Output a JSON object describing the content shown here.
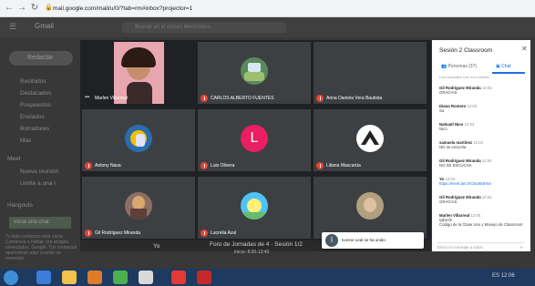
{
  "browser": {
    "url": "mail.google.com/mail/u/0/?tab=rm#inbox?projector=1",
    "back_icon": "arrow-left-icon",
    "forward_icon": "arrow-right-icon",
    "reload_icon": "reload-icon",
    "lock_icon": "lock-icon"
  },
  "gmail": {
    "logo": "Gmail",
    "search_placeholder": "Buscar en el correo electrónico",
    "compose_label": "Redactar",
    "sidebar": [
      {
        "label": "Recibidos",
        "icon": "inbox-icon"
      },
      {
        "label": "Destacados",
        "icon": "star-icon"
      },
      {
        "label": "Pospuestos",
        "icon": "clock-icon"
      },
      {
        "label": "Enviados",
        "icon": "send-icon"
      },
      {
        "label": "Borradores",
        "icon": "draft-icon"
      },
      {
        "label": "Más",
        "icon": "chevron-down-icon"
      }
    ],
    "meet_header": "Meet",
    "meet_items": [
      {
        "label": "Nueva reunión",
        "icon": "video-icon"
      },
      {
        "label": "Unirte a una r",
        "icon": "keyboard-icon"
      }
    ],
    "hangouts_header": "Hangouts",
    "hangouts_button": "Inicia una chat",
    "hangouts_note": "Tu lista contactos está vacía Comienza a hablar con amigos conectados. Google. Tus contactos aparecerán aquí cuando se conecten."
  },
  "meet": {
    "tiles": [
      {
        "name": "Marlen Villarreal",
        "avatar": "camera-video",
        "bg": "#e8a7b0",
        "muted": false
      },
      {
        "name": "CARLOS ALBERTO FUENTES",
        "avatar": "photo",
        "bg": "#5a8a5a",
        "muted": true
      },
      {
        "name": "Anna Daniela Vera Bautista",
        "avatar": "none",
        "bg": "#3c4043",
        "muted": true
      },
      {
        "name": "Antony Nava",
        "avatar": "photo",
        "bg": "#2b6cb0",
        "muted": true
      },
      {
        "name": "Luis Olivera",
        "avatar": "letter",
        "letter": "L",
        "bg": "#e91e63",
        "muted": true
      },
      {
        "name": "Liliana Mascarúa",
        "avatar": "photo",
        "bg": "#ffffff",
        "muted": true
      },
      {
        "name": "Gil Rodríguez Miranda",
        "avatar": "photo",
        "bg": "#8d6e63",
        "muted": true
      },
      {
        "name": "Lucrelia Azul",
        "avatar": "photo",
        "bg": "#4fc3f7",
        "muted": true
      },
      {
        "name": "",
        "avatar": "photo",
        "bg": "#b0a080",
        "muted": false
      }
    ],
    "bottom_yo": "Yo",
    "bottom_title": "Foro de Jornadas de 4 · Sesión 1/2",
    "bottom_sub": "Inicio: 8:00-13:40"
  },
  "chat": {
    "title": "Sesión 2 Classroom",
    "close_icon": "close-icon",
    "people_tab": "Personas (37)",
    "people_icon": "people-icon",
    "chat_tab": "Chat",
    "chat_icon": "chat-icon",
    "people_note": "Los mensajes solo son visibles",
    "messages": [
      {
        "name": "Gil Rodríguez Miranda",
        "time": "12:03",
        "text": "GRACIAS"
      },
      {
        "name": "Diana Romero",
        "time": "12:03",
        "text": "Sa"
      },
      {
        "name": "Nahuatl Nico",
        "time": "12:04",
        "text": "Nico"
      },
      {
        "name": "samuela martinez",
        "time": "12:04",
        "text": "NO se escucha"
      },
      {
        "name": "Gil Rodríguez Miranda",
        "time": "12:04",
        "text": "NO SE ESCUCHA"
      },
      {
        "name": "Yo",
        "time": "12:04",
        "text": "https://meet.be/JXOIa4B4H5s",
        "link": true
      },
      {
        "name": "Gil Rodríguez Miranda",
        "time": "12:04",
        "text": "GRACIAS"
      },
      {
        "name": "Marlen Villarreal",
        "time": "12:05",
        "text": "Código de la Clase Uso y Manejo de Classroom",
        "pre": "Iglmnfn"
      }
    ],
    "send_placeholder": "Envía un mensaje a todos",
    "send_icon": "send-icon"
  },
  "toast": {
    "letter": "I",
    "text": "Ivonne Leal se ha unido"
  },
  "taskbar": {
    "start_icon": "windows-start-icon",
    "apps": [
      "ie-icon",
      "folder-icon",
      "media-player-icon",
      "chrome-icon",
      "gmail-icon",
      "document-icon",
      "screen-icon"
    ],
    "tray": "ES  12:06"
  }
}
